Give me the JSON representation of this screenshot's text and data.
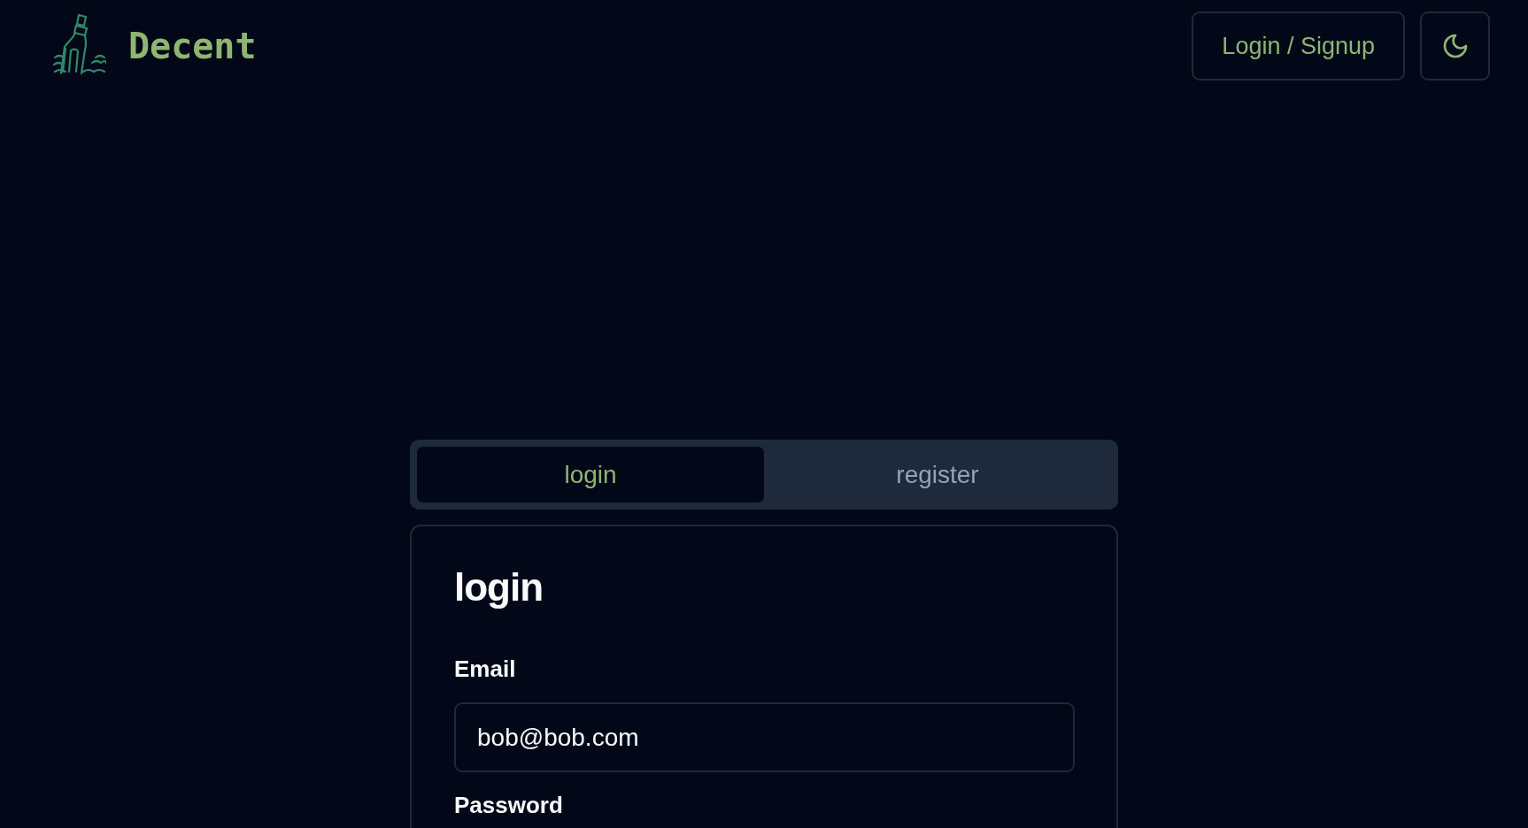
{
  "header": {
    "brand": "Decent",
    "login_button": "Login / Signup"
  },
  "tabs": [
    {
      "label": "login",
      "selected": true
    },
    {
      "label": "register",
      "selected": false
    }
  ],
  "form": {
    "title": "login",
    "fields": [
      {
        "label": "Email",
        "value": "bob@bob.com"
      },
      {
        "label": "Password"
      }
    ]
  }
}
